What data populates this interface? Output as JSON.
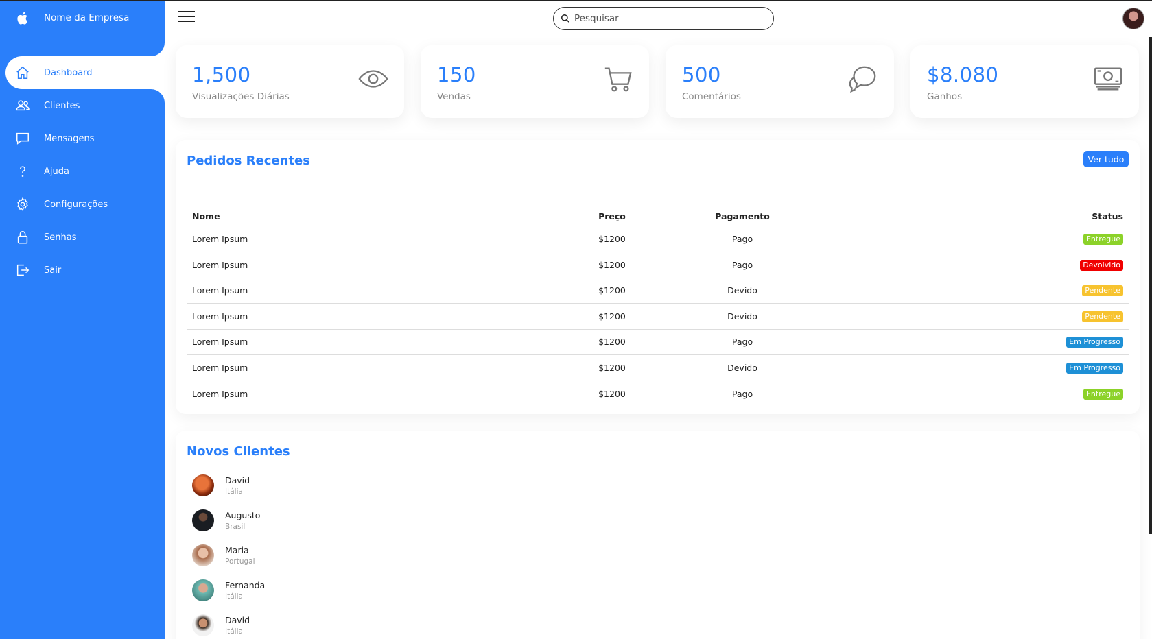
{
  "sidebar": {
    "brand": "Nome da Empresa",
    "brand_icon": "apple-logo-icon",
    "accent": "#2a7ffa",
    "items": [
      {
        "label": "Dashboard",
        "icon": "home-icon",
        "active": true
      },
      {
        "label": "Clientes",
        "icon": "users-icon"
      },
      {
        "label": "Mensagens",
        "icon": "chat-icon"
      },
      {
        "label": "Ajuda",
        "icon": "help-icon"
      },
      {
        "label": "Configurações",
        "icon": "settings-icon"
      },
      {
        "label": "Senhas",
        "icon": "lock-icon"
      },
      {
        "label": "Sair",
        "icon": "logout-icon"
      }
    ]
  },
  "topbar": {
    "menu_icon": "hamburger-icon",
    "search_placeholder": "Pesquisar",
    "search_icon": "search-icon",
    "avatar_icon": "user-avatar"
  },
  "cards": [
    {
      "value": "1,500",
      "label": "Visualizações Diárias",
      "icon": "eye-icon"
    },
    {
      "value": "150",
      "label": "Vendas",
      "icon": "cart-icon"
    },
    {
      "value": "500",
      "label": "Comentários",
      "icon": "comments-icon"
    },
    {
      "value": "$8.080",
      "label": "Ganhos",
      "icon": "cash-icon"
    }
  ],
  "orders": {
    "title": "Pedidos Recentes",
    "view_all": "Ver tudo",
    "columns": [
      "Nome",
      "Preço",
      "Pagamento",
      "Status"
    ],
    "rows": [
      {
        "name": "Lorem Ipsum",
        "price": "$1200",
        "payment": "Pago",
        "status": "Entregue",
        "status_color": "#8cd229"
      },
      {
        "name": "Lorem Ipsum",
        "price": "$1200",
        "payment": "Pago",
        "status": "Devolvido",
        "status_color": "#f00000"
      },
      {
        "name": "Lorem Ipsum",
        "price": "$1200",
        "payment": "Devido",
        "status": "Pendente",
        "status_color": "#f7c32f"
      },
      {
        "name": "Lorem Ipsum",
        "price": "$1200",
        "payment": "Devido",
        "status": "Pendente",
        "status_color": "#f7c32f"
      },
      {
        "name": "Lorem Ipsum",
        "price": "$1200",
        "payment": "Pago",
        "status": "Em Progresso",
        "status_color": "#1e90d6"
      },
      {
        "name": "Lorem Ipsum",
        "price": "$1200",
        "payment": "Devido",
        "status": "Em Progresso",
        "status_color": "#1e90d6"
      },
      {
        "name": "Lorem Ipsum",
        "price": "$1200",
        "payment": "Pago",
        "status": "Entregue",
        "status_color": "#8cd229"
      }
    ]
  },
  "clients": {
    "title": "Novos Clientes",
    "items": [
      {
        "name": "David",
        "country": "Itália"
      },
      {
        "name": "Augusto",
        "country": "Brasil"
      },
      {
        "name": "Maria",
        "country": "Portugal"
      },
      {
        "name": "Fernanda",
        "country": "Itália"
      },
      {
        "name": "David",
        "country": "Itália"
      }
    ]
  }
}
